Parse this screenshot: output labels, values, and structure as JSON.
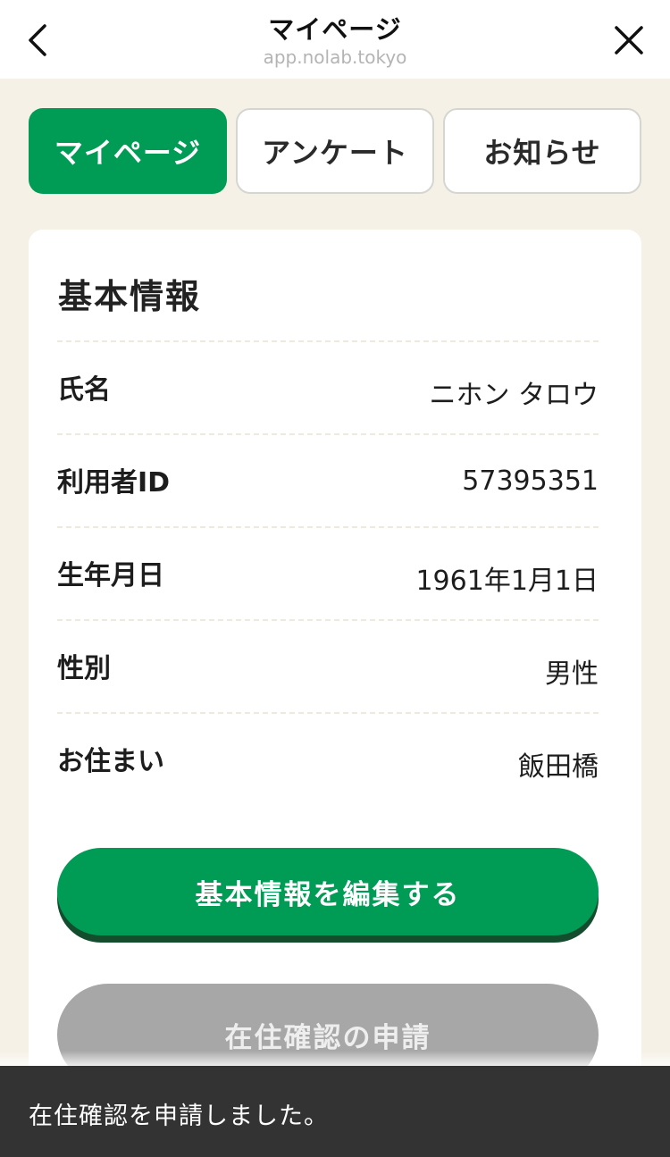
{
  "header": {
    "title": "マイページ",
    "url": "app.nolab.tokyo",
    "back_icon": "chevron-left-icon",
    "close_icon": "close-icon"
  },
  "tabs": [
    {
      "label": "マイページ",
      "active": true
    },
    {
      "label": "アンケート",
      "active": false
    },
    {
      "label": "お知らせ",
      "active": false
    }
  ],
  "basic_info": {
    "title": "基本情報",
    "rows": [
      {
        "label": "氏名",
        "value": "ニホン タロウ"
      },
      {
        "label": "利用者ID",
        "value": "57395351"
      },
      {
        "label": "生年月日",
        "value": "1961年1月1日"
      },
      {
        "label": "性別",
        "value": "男性"
      },
      {
        "label": "お住まい",
        "value": "飯田橋"
      }
    ],
    "edit_button": "基本情報を編集する",
    "residence_button": "在住確認の申請"
  },
  "toast": {
    "message": "在住確認を申請しました。"
  },
  "colors": {
    "accent": "#009b55",
    "background": "#f5f1e6",
    "toast_bg": "#333333",
    "disabled_button": "#a7a7a7"
  }
}
